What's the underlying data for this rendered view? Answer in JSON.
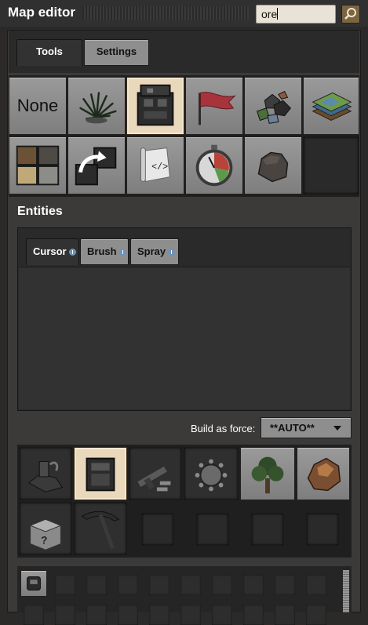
{
  "window": {
    "title": "Map editor"
  },
  "search": {
    "value": "ore"
  },
  "tabs": [
    {
      "label": "Tools",
      "selected": true
    },
    {
      "label": "Settings",
      "selected": false
    }
  ],
  "tools": {
    "row1": [
      {
        "label": "None",
        "icon": "none"
      },
      {
        "icon": "decorative-plant-icon"
      },
      {
        "icon": "entity-editor-icon",
        "selected": true
      },
      {
        "icon": "red-flag-icon"
      },
      {
        "icon": "resources-ore-icon"
      },
      {
        "icon": "tiles-icon"
      }
    ],
    "row2": [
      {
        "icon": "terrain-tiles-icon"
      },
      {
        "icon": "clone-stamp-icon"
      },
      {
        "icon": "script-icon"
      },
      {
        "icon": "stopwatch-icon"
      },
      {
        "icon": "cliff-rock-icon"
      },
      {
        "icon": "empty"
      }
    ]
  },
  "entities": {
    "title": "Entities",
    "subtabs": [
      {
        "label": "Cursor",
        "selected": true
      },
      {
        "label": "Brush",
        "selected": false
      },
      {
        "label": "Spray",
        "selected": false
      }
    ],
    "force_label": "Build as force:",
    "force_value": "**AUTO**"
  },
  "entity_grid": {
    "row1": [
      "wreck-icon",
      "chest-machine-icon",
      "weapons-icon",
      "spiked-mine-icon",
      "tree-icon",
      "ore-rock-icon"
    ],
    "row2": [
      "mystery-box-icon",
      "pickaxe-icon"
    ]
  },
  "colors": {
    "accent_selected": "#e9d8bc",
    "panel_bg": "#3b3a39",
    "button_grey": "#8e8e8e"
  }
}
